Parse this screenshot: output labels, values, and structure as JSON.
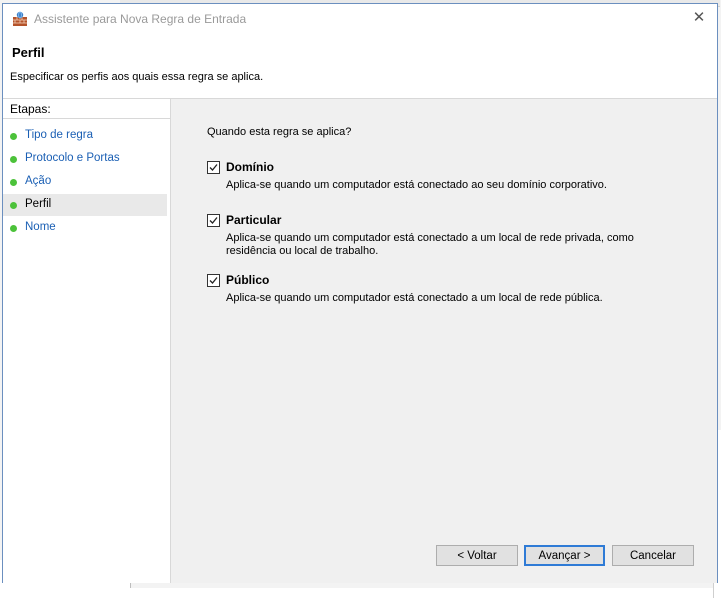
{
  "window": {
    "title": "Assistente para Nova Regra de Entrada",
    "close_glyph": "✕"
  },
  "header": {
    "title": "Perfil",
    "subtitle": "Especificar os perfis aos quais essa regra se aplica."
  },
  "steps": {
    "title": "Etapas:",
    "items": [
      {
        "label": "Tipo de regra"
      },
      {
        "label": "Protocolo e Portas"
      },
      {
        "label": "Ação"
      },
      {
        "label": "Perfil",
        "active": true
      },
      {
        "label": "Nome"
      }
    ]
  },
  "content": {
    "question": "Quando esta regra se aplica?",
    "options": [
      {
        "name": "Domínio",
        "checked": true,
        "description": "Aplica-se quando um computador está conectado ao seu domínio corporativo."
      },
      {
        "name": "Particular",
        "checked": true,
        "description": "Aplica-se quando um computador está conectado a um local de rede privada, como residência ou local de trabalho."
      },
      {
        "name": "Público",
        "checked": true,
        "description": "Aplica-se quando um computador está conectado a um local de rede pública."
      }
    ]
  },
  "buttons": {
    "back": "< Voltar",
    "next": "Avançar >",
    "cancel": "Cancelar"
  },
  "colors": {
    "accent": "#2f7bd6",
    "step_link": "#1a5fb4",
    "step_dot": "#4cc23a",
    "content_bg": "#f0f0f0"
  },
  "icons": {
    "app": "firewall-wall-icon",
    "close": "close-icon",
    "step": "green-dot-icon",
    "check": "checkmark-icon"
  }
}
